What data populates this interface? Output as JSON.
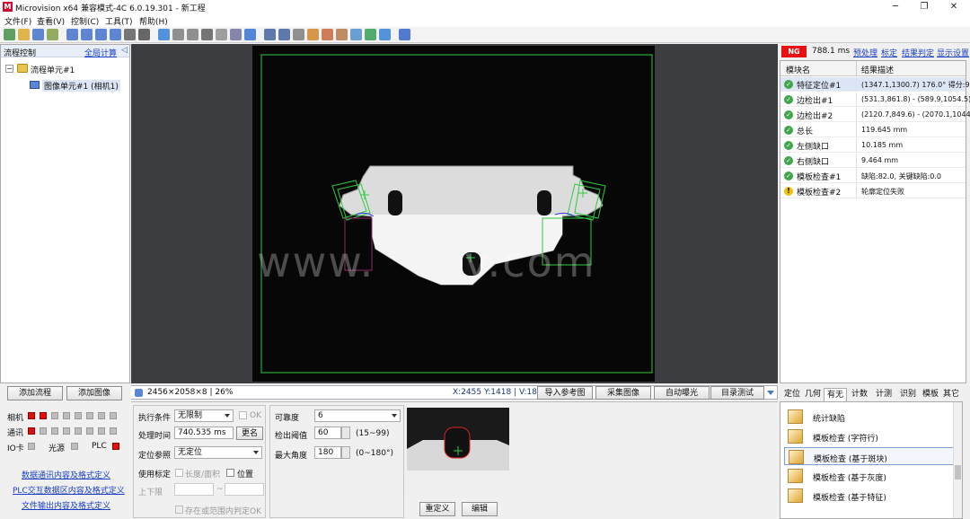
{
  "window": {
    "title": "Microvision x64 兼容模式-4C 6.0.19.301 - 新工程",
    "logo_text": "M",
    "minimize": "─",
    "maximize": "❐",
    "close": "✕"
  },
  "menu": [
    "文件(F)",
    "查看(V)",
    "控制(C)",
    "工具(T)",
    "帮助(H)"
  ],
  "toolbar_icons": [
    "new-icon",
    "open-icon",
    "save-icon",
    "grid-icon",
    "zoom-in-icon",
    "zoom-out-icon",
    "zoom-fit-icon",
    "zoom-actual-icon",
    "eye-icon",
    "crosshair-icon",
    "play-icon",
    "pause-icon",
    "stop-icon",
    "crop-icon",
    "camera-icon",
    "chart-icon",
    "list-icon",
    "fit-window-icon",
    "stretch-icon",
    "print-icon",
    "refresh-icon",
    "export-icon",
    "config-icon",
    "image-icon",
    "gear-icon",
    "gear-alt-icon",
    "info-icon"
  ],
  "flow": {
    "header": "流程控制",
    "compute_all": "全局计算",
    "collapse": "◁",
    "tree_root": "流程单元#1",
    "tree_child": "图像单元#1 (相机1)",
    "add_flow": "添加流程",
    "add_image": "添加图像"
  },
  "status": {
    "camera_label": "相机",
    "comm_label": "通讯",
    "io_label": "IO卡",
    "light_label": "光源",
    "plc_label": "PLC",
    "camera_leds": [
      true,
      true,
      false,
      false,
      false,
      false,
      false,
      false
    ],
    "comm_leds": [
      true,
      false,
      false,
      false,
      false,
      false,
      false,
      false
    ],
    "io_led": false,
    "light_led": false,
    "plc_led": true
  },
  "links": [
    "数据通讯内容及格式定义",
    "PLC交互数据区内容及格式定义",
    "文件输出内容及格式定义"
  ],
  "image": {
    "watermark": "www.      v.com",
    "info": "2456×2058×8 | 26%",
    "coords": "X:2455 Y:1418 | V:18",
    "import_ref": "导入参考图",
    "capture": "采集图像",
    "auto_exposure": "自动曝光",
    "dir_test": "目录测试"
  },
  "config": {
    "exec_cond_label": "执行条件",
    "exec_cond_value": "无限制",
    "ok_label": "OK",
    "proc_time_label": "处理时间",
    "proc_time_value": "740.535 ms",
    "rename": "更名",
    "locate_ref_label": "定位参照",
    "locate_ref_value": "无定位",
    "use_calib_label": "使用标定",
    "len_area_label": "长度/面积",
    "position_label": "位置",
    "bounds_label": "上下限",
    "tilde": "~",
    "in_range_label": "存在或范围内判定OK",
    "confidence_label": "可靠度",
    "confidence_value": "6",
    "threshold_label": "检出阈值",
    "threshold_value": "60",
    "threshold_range": "(15~99)",
    "max_angle_label": "最大角度",
    "max_angle_value": "180",
    "max_angle_range": "(0~180°)",
    "redefine": "重定义",
    "edit": "编辑"
  },
  "results": {
    "ng": "NG",
    "time": "788.1 ms",
    "links": [
      "预处理",
      "标定",
      "结果判定",
      "显示设置"
    ],
    "col_name": "模块名",
    "col_desc": "结果描述",
    "rows": [
      {
        "status": "ok",
        "name": "特征定位#1",
        "desc": "(1347.1,1300.7) 176.0° 得分:99"
      },
      {
        "status": "ok",
        "name": "边检出#1",
        "desc": "(531.3,861.8) - (589.9,1054.5)"
      },
      {
        "status": "ok",
        "name": "边检出#2",
        "desc": "(2120.7,849.6) - (2070.1,1044.7)"
      },
      {
        "status": "ok",
        "name": "总长",
        "desc": "119.645 mm"
      },
      {
        "status": "ok",
        "name": "左侧缺口",
        "desc": "10.185 mm"
      },
      {
        "status": "ok",
        "name": "右侧缺口",
        "desc": "9.464 mm"
      },
      {
        "status": "ok",
        "name": "模板检查#1",
        "desc": "缺陷:82.0, 关键缺陷:0.0"
      },
      {
        "status": "warn",
        "name": "模板检查#2",
        "desc": "轮廓定位失败"
      }
    ]
  },
  "tabs": [
    "定位",
    "几何",
    "有无",
    "计数",
    "计测",
    "识别",
    "模板",
    "其它"
  ],
  "active_tab": "有无",
  "tools": [
    "统计缺陷",
    "模板检查 (字符行)",
    "模板检查 (基于斑块)",
    "模板检查 (基于灰度)",
    "模板检查 (基于特征)"
  ],
  "selected_tool": 2
}
